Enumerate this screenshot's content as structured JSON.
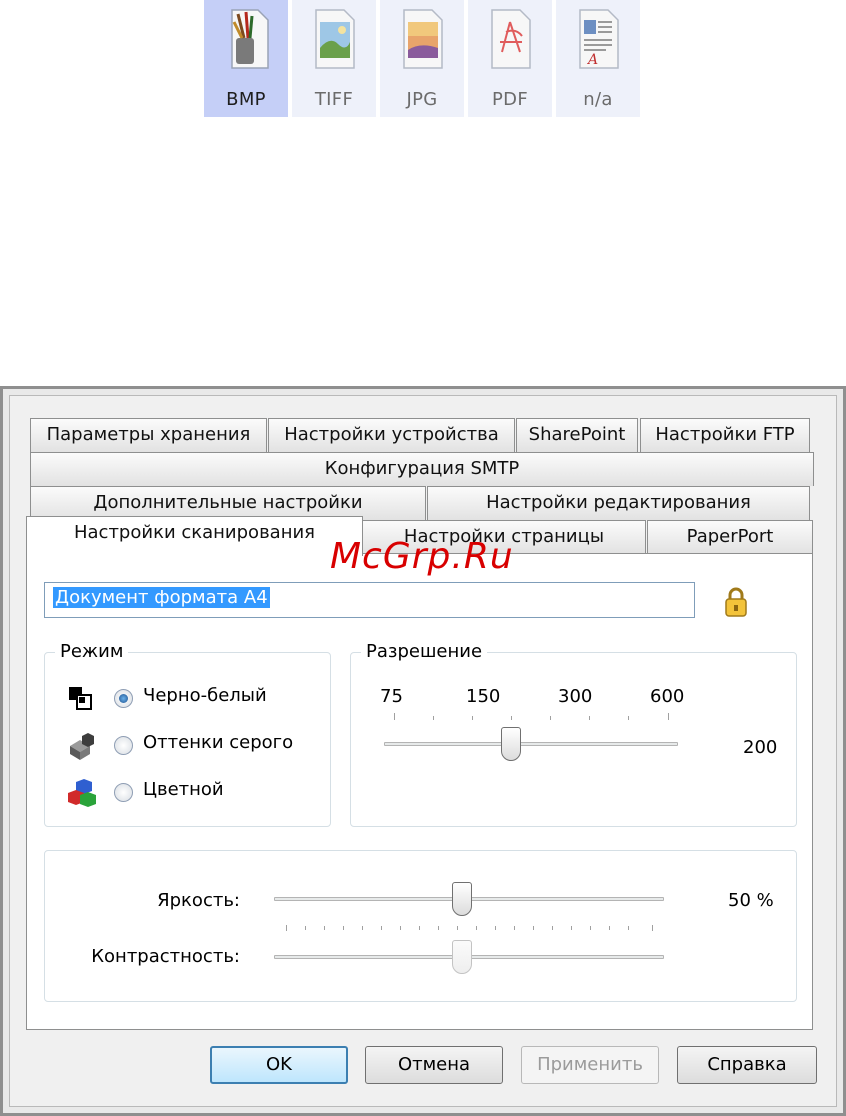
{
  "formats": [
    {
      "label": "BMP",
      "active": true,
      "icon": "bmp-file-icon"
    },
    {
      "label": "TIFF",
      "active": false,
      "icon": "tiff-file-icon"
    },
    {
      "label": "JPG",
      "active": false,
      "icon": "jpg-file-icon"
    },
    {
      "label": "PDF",
      "active": false,
      "icon": "pdf-file-icon"
    },
    {
      "label": "n/a",
      "active": false,
      "icon": "text-file-icon"
    }
  ],
  "tabs": {
    "row1": [
      "Параметры хранения",
      "Настройки устройства",
      "SharePoint",
      "Настройки FTP"
    ],
    "row2": [
      "Конфигурация SMTP"
    ],
    "row3": [
      "Дополнительные настройки",
      "Настройки редактирования"
    ],
    "row4": [
      "Настройки сканирования",
      "Настройки страницы",
      "PaperPort"
    ]
  },
  "watermark": "McGrp.Ru",
  "name_field": {
    "value": "Документ формата A4"
  },
  "mode": {
    "title": "Режим",
    "options": [
      "Черно-белый",
      "Оттенки серого",
      "Цветной"
    ],
    "selected": 0
  },
  "resolution": {
    "title": "Разрешение",
    "ticks": [
      "75",
      "150",
      "300",
      "600"
    ],
    "value": "200"
  },
  "brightness": {
    "label": "Яркость:",
    "value_text": "50 %",
    "level": 0.5
  },
  "contrast": {
    "label": "Контрастность:",
    "level": 0.5
  },
  "buttons": {
    "ok": "OK",
    "cancel": "Отмена",
    "apply": "Применить",
    "help": "Справка"
  },
  "colors": {
    "selection": "#3399ff",
    "active_format": "#c5cff7",
    "default_button": "#3c7fb1"
  }
}
